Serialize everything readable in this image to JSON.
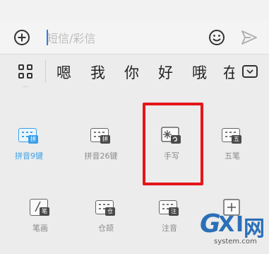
{
  "compose": {
    "placeholder": "短信/彩信"
  },
  "candidates": [
    "嗯",
    "我",
    "你",
    "好",
    "哦",
    "在"
  ],
  "tools": [
    {
      "label": "拼音9键",
      "badge": "拼",
      "active": true
    },
    {
      "label": "拼音26键",
      "badge": "拼",
      "active": false
    },
    {
      "label": "手写",
      "badge": "",
      "active": false
    },
    {
      "label": "五笔",
      "badge": "五",
      "active": false
    },
    {
      "label": "笔画",
      "badge": "笔",
      "active": false
    },
    {
      "label": "仓颉",
      "badge": "仓",
      "active": false
    },
    {
      "label": "注音",
      "badge": "注",
      "active": false
    },
    {
      "label": "",
      "badge": "",
      "active": false
    }
  ],
  "colors": {
    "accent": "#3aa0e8",
    "highlight_box": "#e3161b",
    "watermark": "#2c6fb7"
  },
  "watermark": {
    "g": "G",
    "x": "X",
    "i": "I",
    "w": "网",
    "site": "system.com"
  }
}
